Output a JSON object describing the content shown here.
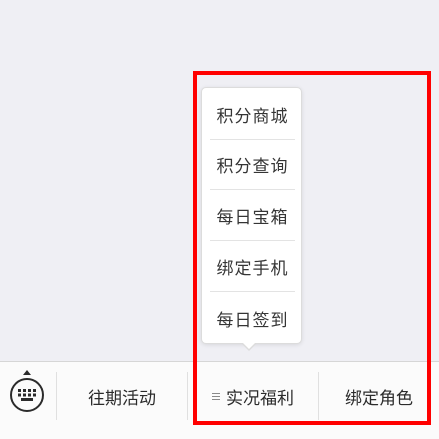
{
  "popup": {
    "items": [
      {
        "label": "积分商城"
      },
      {
        "label": "积分查询"
      },
      {
        "label": "每日宝箱"
      },
      {
        "label": "绑定手机"
      },
      {
        "label": "每日签到"
      }
    ]
  },
  "bottom_bar": {
    "keyboard_icon": "keyboard-icon",
    "menus": [
      {
        "label": "往期活动"
      },
      {
        "label": "实况福利"
      },
      {
        "label": "绑定角色"
      }
    ]
  },
  "colors": {
    "highlight": "#ff0000",
    "background": "#efeff4",
    "text": "#353535"
  }
}
